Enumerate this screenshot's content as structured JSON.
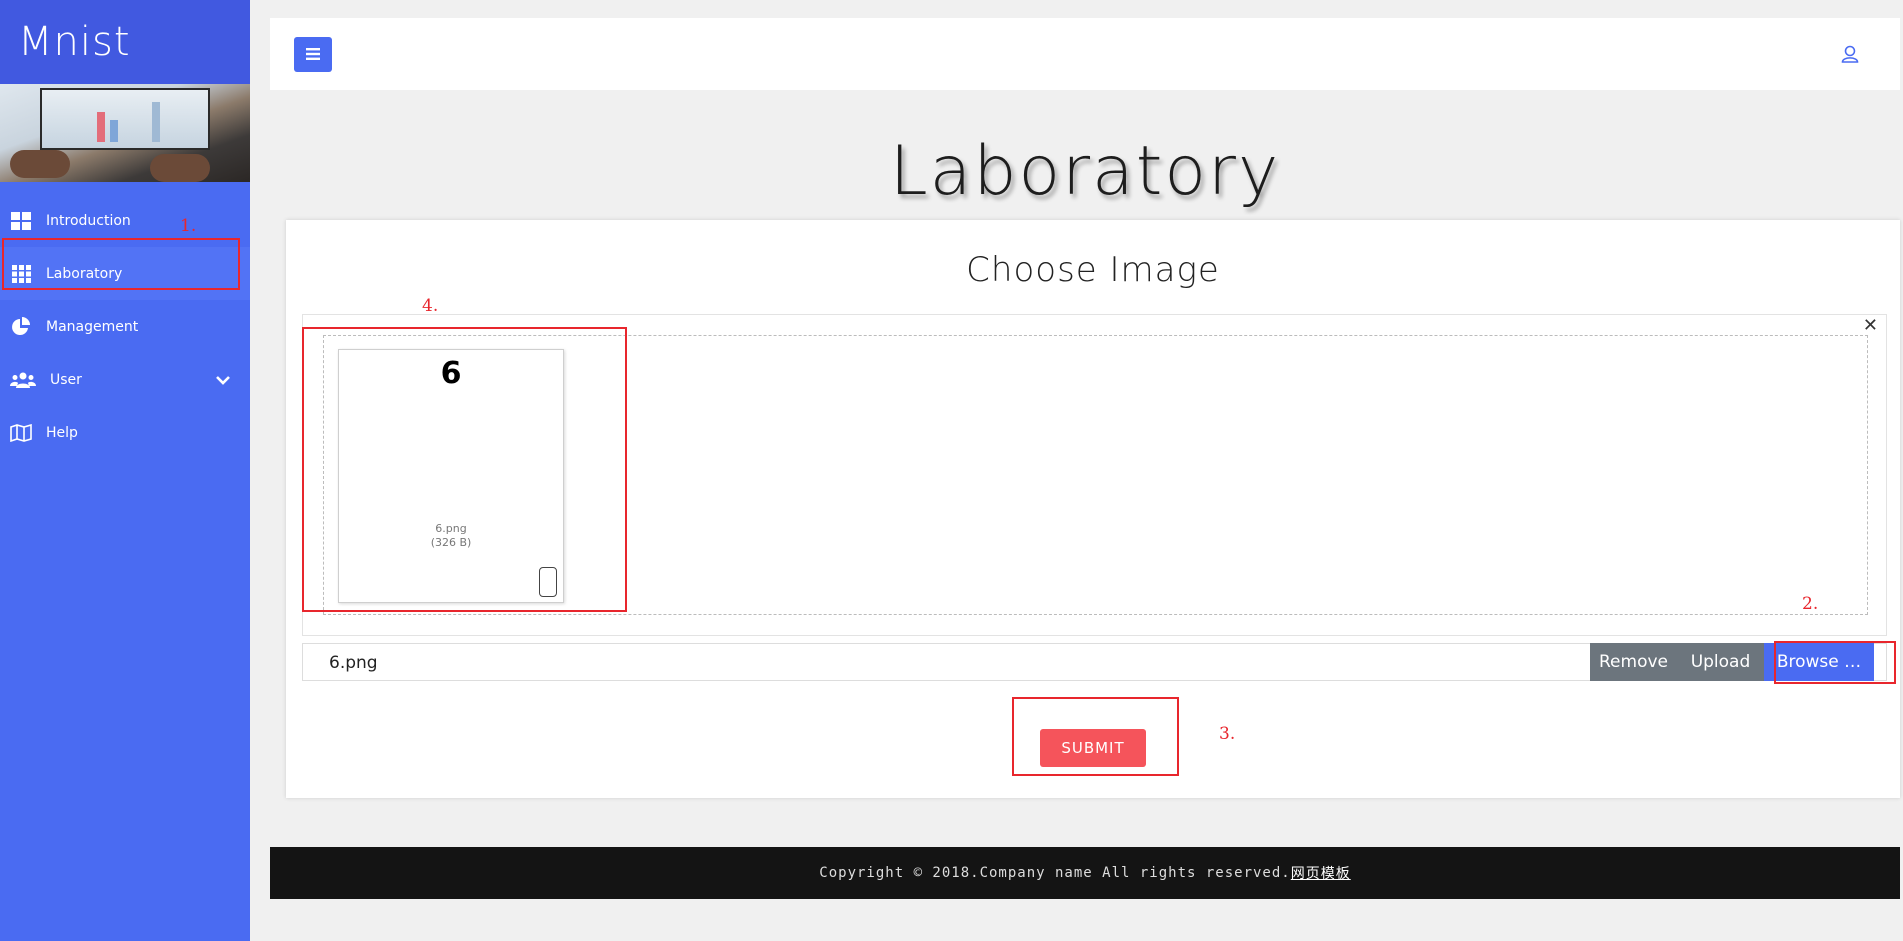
{
  "sidebar": {
    "logo": "Mnist",
    "items": [
      {
        "label": "Introduction",
        "icon": "grid-four-icon"
      },
      {
        "label": "Laboratory",
        "icon": "grid-nine-icon"
      },
      {
        "label": "Management",
        "icon": "pie-chart-icon"
      },
      {
        "label": "User",
        "icon": "users-icon"
      },
      {
        "label": "Help",
        "icon": "map-icon"
      }
    ],
    "active_item": "Laboratory"
  },
  "header": {
    "menu_icon": "hamburger-menu-icon",
    "user_icon": "user-icon"
  },
  "page": {
    "title": "Laboratory",
    "card_title": "Choose Image"
  },
  "file_input": {
    "preview": {
      "digit": "6",
      "file_name": "6.png",
      "file_size": "(326 B)"
    },
    "caption": "6.png",
    "remove_label": "Remove",
    "upload_label": "Upload",
    "browse_label": "Browse …"
  },
  "submit_label": "SUBMIT",
  "footer": {
    "text": "Copyright © 2018.Company name All rights reserved.",
    "link_text": "网页模板"
  },
  "annotations": [
    "1.",
    "2.",
    "3.",
    "4."
  ],
  "colors": {
    "primary": "#4a6bf2",
    "sidebar_dark": "#4159e0",
    "danger": "#f5545b",
    "secondary": "#6c757d",
    "footer_bg": "#141414",
    "annotation": "#e8262d"
  }
}
